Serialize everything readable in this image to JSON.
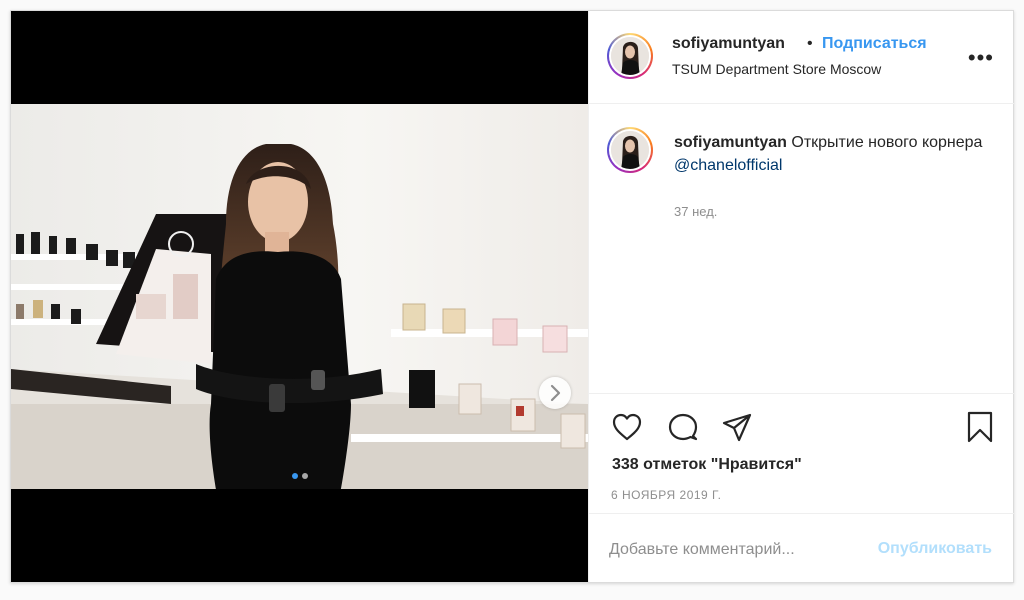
{
  "header": {
    "username": "sofiyamuntyan",
    "separator": "•",
    "follow_label": "Подписаться",
    "location": "TSUM Department Store Moscow",
    "more_icon": "more-horizontal-icon",
    "more_label": "•••"
  },
  "caption": {
    "username": "sofiyamuntyan",
    "text": "Открытие нового корнера",
    "mention": "@chanelofficial",
    "time_ago": "37 нед."
  },
  "actions": {
    "like_icon": "heart-icon",
    "comment_icon": "comment-icon",
    "share_icon": "share-icon",
    "save_icon": "bookmark-icon"
  },
  "likes_text": "338 отметок \"Нравится\"",
  "date_text": "6 НОЯБРЯ 2019 Г.",
  "comment": {
    "placeholder": "Добавьте комментарий...",
    "post_label": "Опубликовать"
  },
  "carousel": {
    "current": 1,
    "total": 2,
    "next_icon": "chevron-right-icon"
  },
  "colors": {
    "link_blue": "#3897f0",
    "mention_blue": "#00376b",
    "post_disabled": "#b2dffc"
  }
}
